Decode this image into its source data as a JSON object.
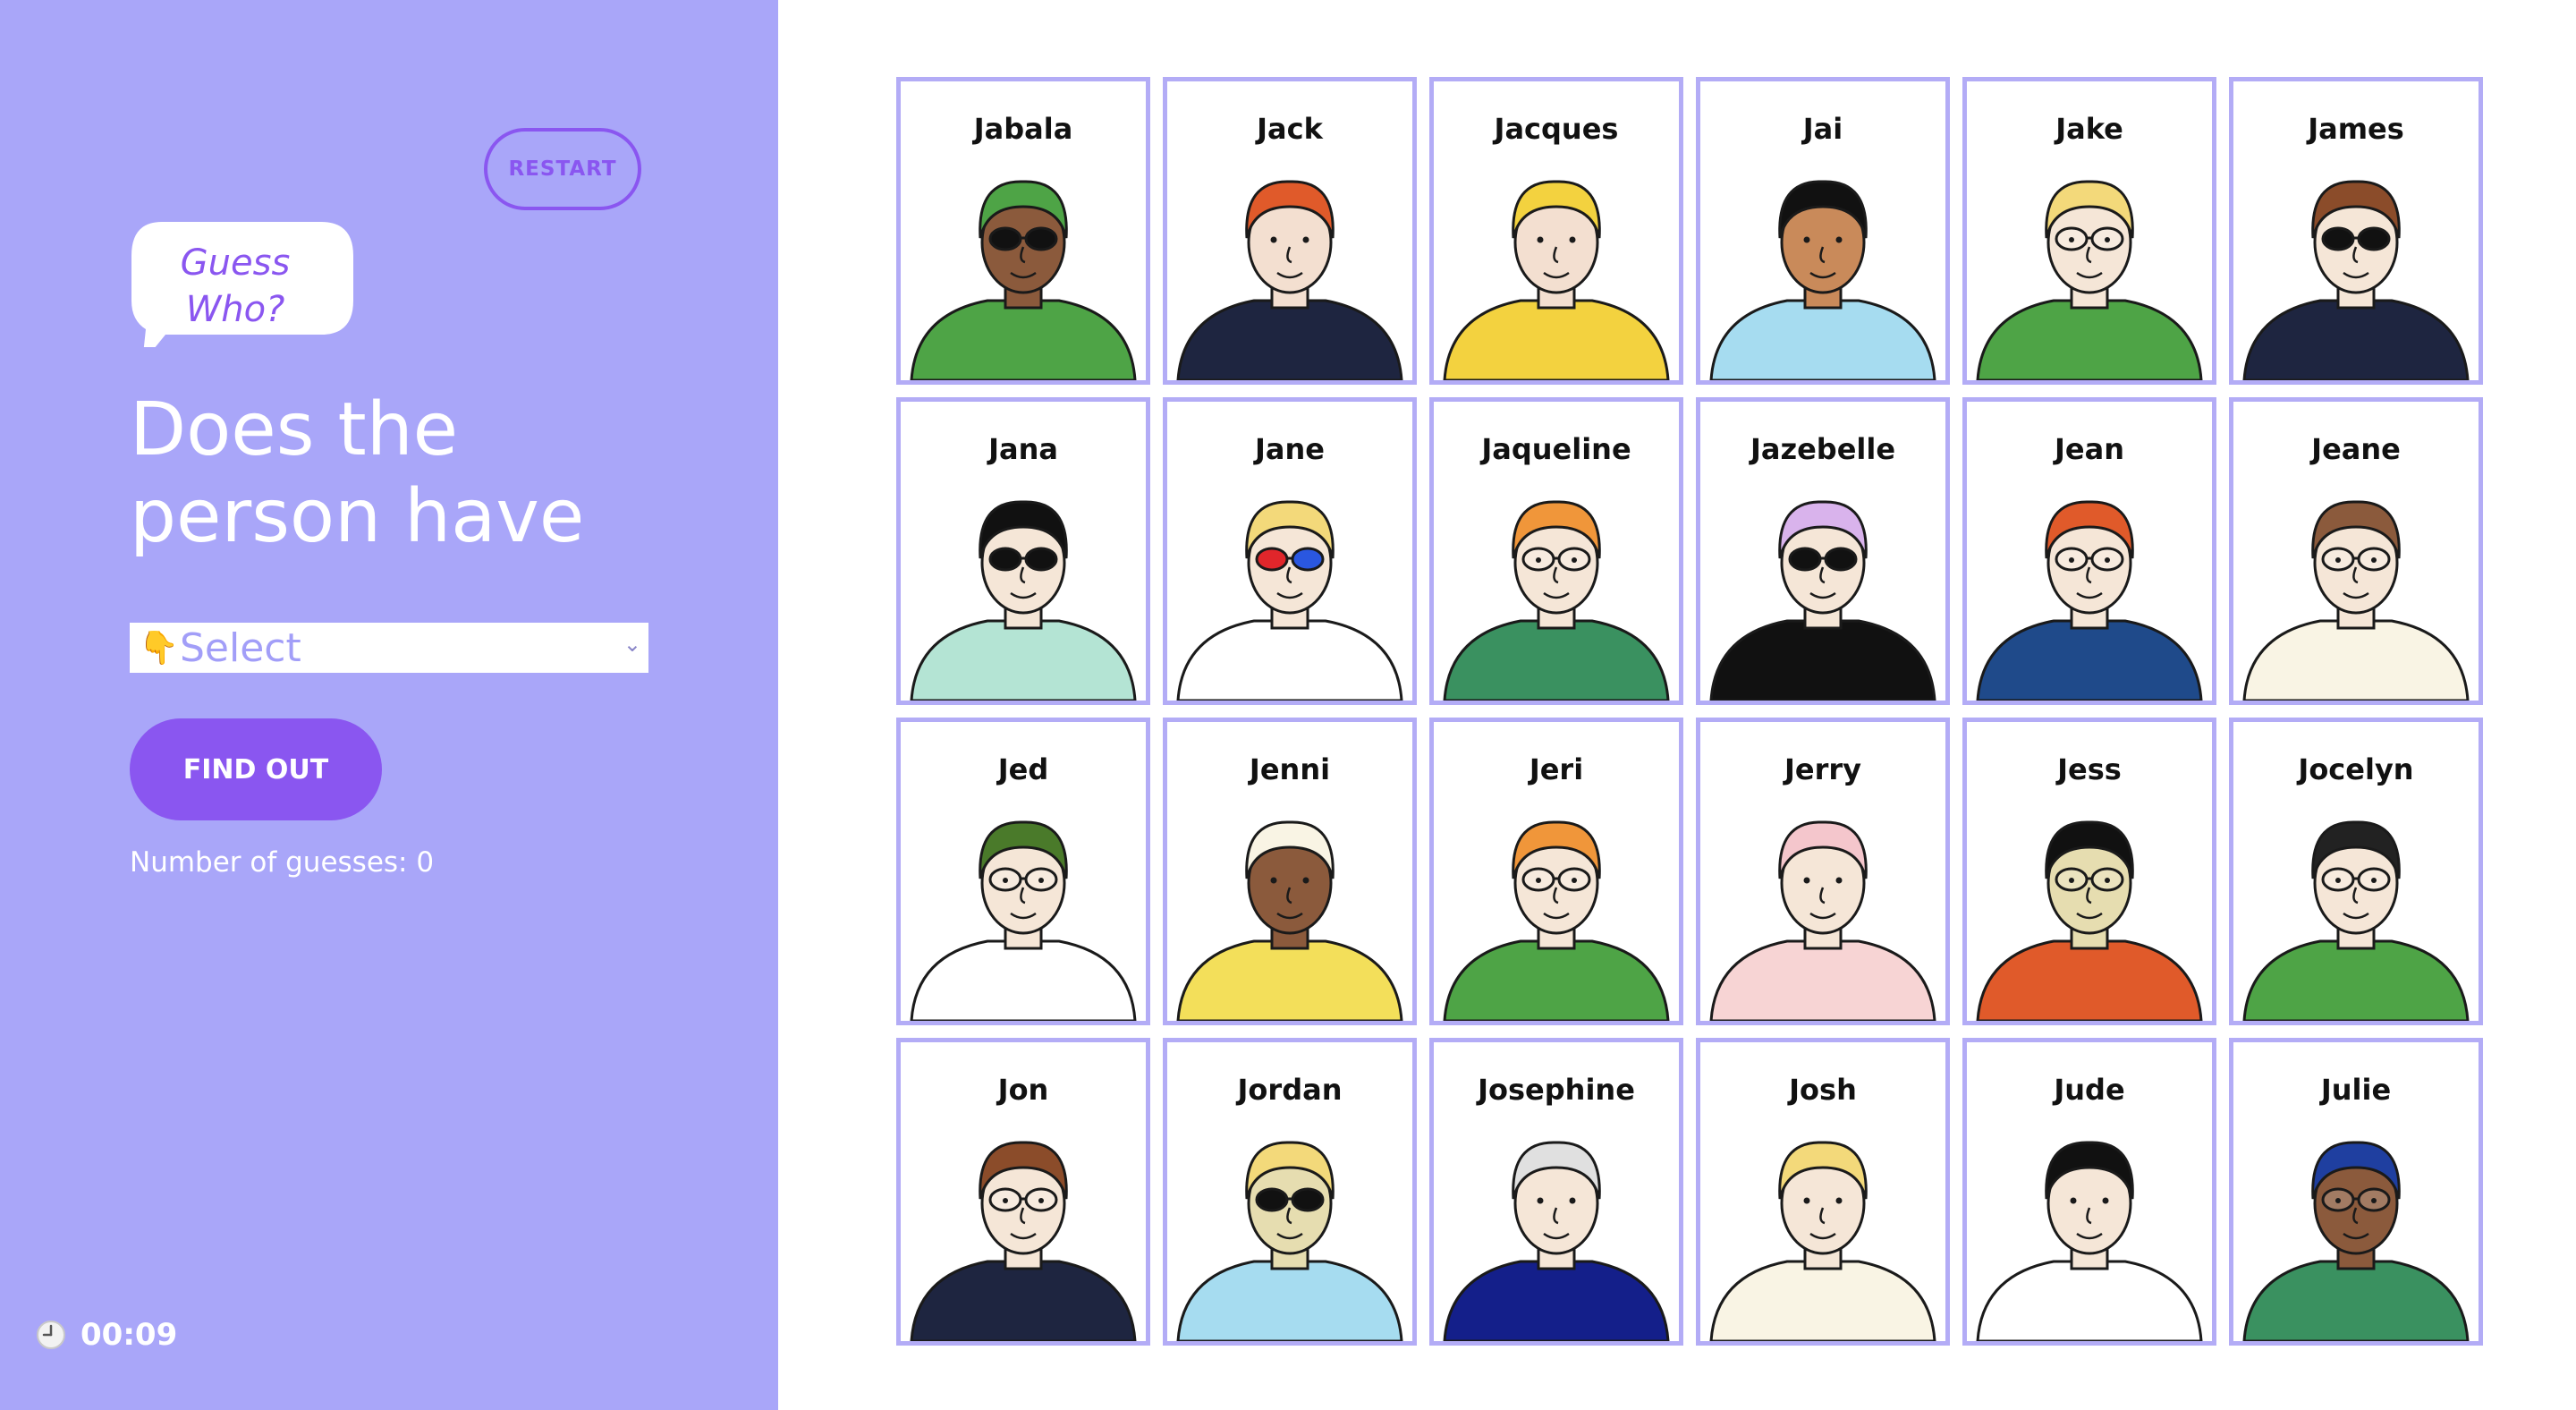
{
  "sidebar": {
    "restart_label": "RESTART",
    "logo_line1": "Guess",
    "logo_line2": "Who?",
    "question": "Does the person have",
    "select": {
      "hand_icon": "👇",
      "placeholder": "Select"
    },
    "find_out_label": "FIND OUT",
    "guesses_text": "Number of guesses: 0",
    "timer": "00:09"
  },
  "colors": {
    "sidebar_bg": "#a9a6f9",
    "accent": "#8a56f0",
    "card_border": "#b3acf6"
  },
  "characters": [
    {
      "name": "Jabala",
      "hair": "#4ea446",
      "skin": "#8b5a3c",
      "shirt": "#4ea446",
      "glasses": "sun"
    },
    {
      "name": "Jack",
      "hair": "#e05a2a",
      "skin": "#f3dfd0",
      "shirt": "#1e2540",
      "glasses": "none"
    },
    {
      "name": "Jacques",
      "hair": "#f3d23f",
      "skin": "#f3dfd0",
      "shirt": "#f3d23f",
      "glasses": "none"
    },
    {
      "name": "Jai",
      "hair": "#111111",
      "skin": "#c98a5a",
      "shirt": "#a6dcf0",
      "glasses": "none"
    },
    {
      "name": "Jake",
      "hair": "#f3d97a",
      "skin": "#f5e6d7",
      "shirt": "#4ea446",
      "glasses": "clear"
    },
    {
      "name": "James",
      "hair": "#8b4c2a",
      "skin": "#f5e6d7",
      "shirt": "#1e2540",
      "glasses": "sun"
    },
    {
      "name": "Jana",
      "hair": "#111111",
      "skin": "#f5e6d7",
      "shirt": "#b4e4d4",
      "glasses": "sun"
    },
    {
      "name": "Jane",
      "hair": "#f3d97a",
      "skin": "#f5e6d7",
      "shirt": "#ffffff",
      "glasses": "color"
    },
    {
      "name": "Jaqueline",
      "hair": "#f0963a",
      "skin": "#f5e6d7",
      "shirt": "#3a9160",
      "glasses": "clear"
    },
    {
      "name": "Jazebelle",
      "hair": "#d9b3ec",
      "skin": "#f5e6d7",
      "shirt": "#111111",
      "glasses": "sun"
    },
    {
      "name": "Jean",
      "hair": "#e05a2a",
      "skin": "#f5e6d7",
      "shirt": "#1f4a8a",
      "glasses": "clear"
    },
    {
      "name": "Jeane",
      "hair": "#8b5a3c",
      "skin": "#f5e6d7",
      "shirt": "#f9f4e4",
      "glasses": "clear"
    },
    {
      "name": "Jed",
      "hair": "#4a7a2a",
      "skin": "#f5e6d7",
      "shirt": "#ffffff",
      "glasses": "clear"
    },
    {
      "name": "Jenni",
      "hair": "#f9f4e4",
      "skin": "#8b5a3c",
      "shirt": "#f3df5a",
      "glasses": "none"
    },
    {
      "name": "Jeri",
      "hair": "#f0963a",
      "skin": "#f5e6d7",
      "shirt": "#4ea446",
      "glasses": "clear"
    },
    {
      "name": "Jerry",
      "hair": "#f4c6cc",
      "skin": "#f5e6d7",
      "shirt": "#f7d4d4",
      "glasses": "none"
    },
    {
      "name": "Jess",
      "hair": "#111111",
      "skin": "#e6ddb0",
      "shirt": "#e05a2a",
      "glasses": "clear"
    },
    {
      "name": "Jocelyn",
      "hair": "#222222",
      "skin": "#f5e6d7",
      "shirt": "#4ea446",
      "glasses": "clear"
    },
    {
      "name": "Jon",
      "hair": "#8b4c2a",
      "skin": "#f5e6d7",
      "shirt": "#1e2540",
      "glasses": "clear"
    },
    {
      "name": "Jordan",
      "hair": "#f3d97a",
      "skin": "#e6ddb0",
      "shirt": "#a6dcf0",
      "glasses": "sun"
    },
    {
      "name": "Josephine",
      "hair": "#e0e0e0",
      "skin": "#f5e6d7",
      "shirt": "#141f8a",
      "glasses": "none"
    },
    {
      "name": "Josh",
      "hair": "#f3d97a",
      "skin": "#f5e6d7",
      "shirt": "#f9f4e4",
      "glasses": "none"
    },
    {
      "name": "Jude",
      "hair": "#111111",
      "skin": "#f5e6d7",
      "shirt": "#ffffff",
      "glasses": "none"
    },
    {
      "name": "Julie",
      "hair": "#1f3fa0",
      "skin": "#8b5a3c",
      "shirt": "#3a9160",
      "glasses": "clear"
    }
  ]
}
